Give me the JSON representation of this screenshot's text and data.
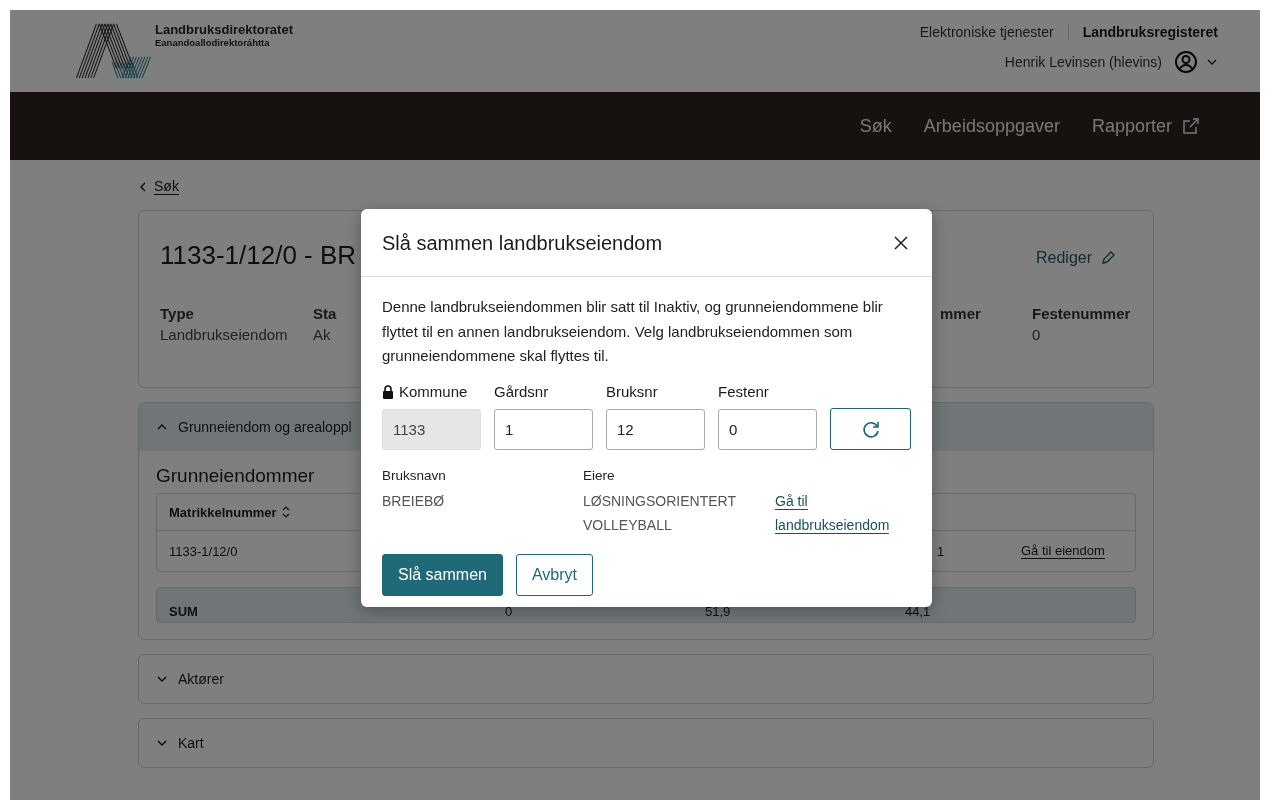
{
  "header": {
    "org_name": "Landbruksdirektoratet",
    "org_subname": "Eanandoallodirektoráhtta",
    "links": [
      {
        "label": "Elektroniske tjenester",
        "selected": false
      },
      {
        "label": "Landbruksregisteret",
        "selected": true
      }
    ],
    "user": "Henrik Levinsen (hlevins)"
  },
  "nav": [
    {
      "label": "Søk",
      "external": false
    },
    {
      "label": "Arbeidsoppgaver",
      "external": false
    },
    {
      "label": "Rapporter",
      "external": true
    }
  ],
  "back_link": "Søk",
  "property": {
    "title": "1133-1/12/0 - BR",
    "edit": "Rediger",
    "fields": [
      {
        "label": "Type",
        "value": "Landbrukseiendom"
      },
      {
        "label": "Sta",
        "value": "Ak"
      },
      {
        "label": "mmer"
      },
      {
        "label": "Festenummer",
        "value": "0"
      }
    ]
  },
  "sections": [
    {
      "title": "Grunneiendom og arealoppl",
      "expanded": true,
      "heading": "Grunneiendommer",
      "table": {
        "columns": [
          {
            "label": "Matrikkelnummer",
            "sortable": true
          }
        ],
        "rows": [
          {
            "cells": [
              "1133-1/12/0",
              null,
              null,
              "1"
            ],
            "link": "Gå til eiendom"
          }
        ],
        "sum": [
          "SUM",
          "0",
          "51,9",
          "44,1"
        ]
      }
    },
    {
      "title": "Aktører",
      "expanded": false
    },
    {
      "title": "Kart",
      "expanded": false
    }
  ],
  "dialog": {
    "title": "Slå sammen landbrukseiendom",
    "text": "Denne landbrukseiendommen blir satt til Inaktiv, og grunneiendommene blir flyttet til en annen landbrukseiendom. Velg landbrukseiendommen som grunneiendommene skal flyttes til.",
    "fields": [
      {
        "label": "Kommune",
        "value": "1133",
        "disabled": true
      },
      {
        "label": "Gårdsnr",
        "value": "1",
        "disabled": false
      },
      {
        "label": "Bruksnr",
        "value": "12",
        "disabled": false
      },
      {
        "label": "Festenr",
        "value": "0",
        "disabled": false
      }
    ],
    "info": [
      {
        "label": "Bruksnavn",
        "value": "BREIEBØ"
      },
      {
        "label": "Eiere",
        "value": "LØSNINGSORIENTERT VOLLEYBALL",
        "link": "Gå til landbrukseiendom"
      }
    ],
    "buttons": [
      {
        "label": "Slå sammen",
        "kind": "primary"
      },
      {
        "label": "Avbryt",
        "kind": "secondary"
      }
    ]
  }
}
